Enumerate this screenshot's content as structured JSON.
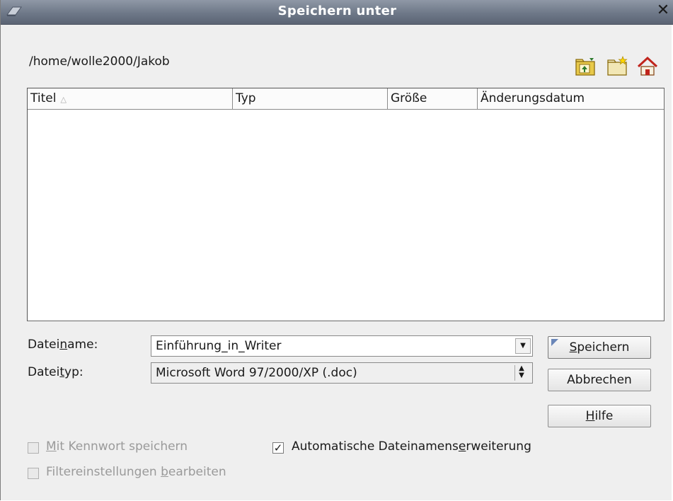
{
  "window": {
    "title": "Speichern unter",
    "close_symbol": "✕"
  },
  "path": "/home/wolle2000/Jakob",
  "toolbar": {
    "icons": [
      "folder-up-icon",
      "new-folder-icon",
      "home-icon"
    ]
  },
  "filelist": {
    "columns": [
      {
        "label": "Titel",
        "sort": "△"
      },
      {
        "label": "Typ"
      },
      {
        "label": "Größe"
      },
      {
        "label": "Änderungsdatum"
      }
    ],
    "rows": []
  },
  "form": {
    "filename_label_pre": "Datei",
    "filename_label_mn": "n",
    "filename_label_post": "ame:",
    "filename_value": "Einführung_in_Writer",
    "filetype_label_pre": "Datei",
    "filetype_label_mn": "t",
    "filetype_label_post": "yp:",
    "filetype_value": "Microsoft Word 97/2000/XP (.doc)"
  },
  "buttons": {
    "save_mn": "S",
    "save_rest": "peichern",
    "cancel": "Abbrechen",
    "help_mn": "H",
    "help_rest": "ilfe"
  },
  "options": {
    "password_mn": "M",
    "password_rest": "it Kennwort speichern",
    "password_checked": false,
    "autoext_pre": "Automatische Dateinamens",
    "autoext_mn": "e",
    "autoext_post": "rweiterung",
    "autoext_checked": true,
    "filter_pre": "Filtereinstellungen ",
    "filter_mn": "b",
    "filter_post": "earbeiten",
    "filter_checked": false
  }
}
